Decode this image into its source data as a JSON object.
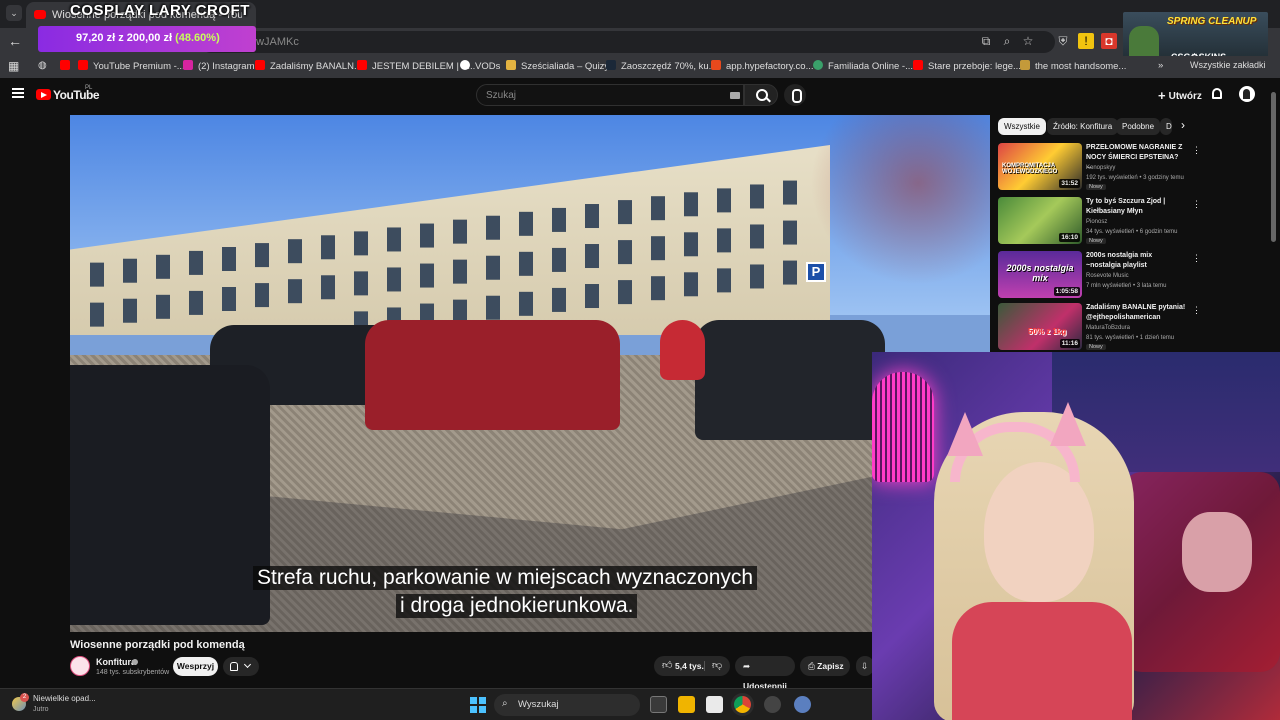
{
  "browser": {
    "active_tab_title": "Wiosenne porządki pod komendą - YouTube",
    "url_visible": "...DobFwJAMKc",
    "bookmarks": [
      {
        "label": "YouTube Premium -..."
      },
      {
        "label": "(2) Instagram"
      },
      {
        "label": "Zadaliśmy BANALN..."
      },
      {
        "label": "JESTEM DEBILEM | Z..."
      },
      {
        "label": "VODs"
      },
      {
        "label": "Sześcialiada – Quizy..."
      },
      {
        "label": "Zaoszczędź 70%, ku..."
      },
      {
        "label": "app.hypefactory.co..."
      },
      {
        "label": "Familiada Online -..."
      },
      {
        "label": "Stare przeboje: lege..."
      },
      {
        "label": "the most handsome..."
      }
    ],
    "all_bookmarks_label": "Wszystkie zakładki"
  },
  "stream_overlay": {
    "title": "COSPLAY LARY CROFT",
    "donation_amount": "97,20 zł",
    "donation_sep": "z",
    "donation_goal": "200,00 zł",
    "donation_pct": "(48.60%)",
    "promo_line1": "SPRING CLEANUP",
    "promo_line2": "CSG⚙SKINS"
  },
  "youtube": {
    "logo_text": "YouTube",
    "logo_region": "PL",
    "search_placeholder": "Szukaj",
    "create_label": "Utwórz",
    "video": {
      "subtitle_line1": "Strefa ruchu, parkowanie w miejscach wyznaczonych",
      "subtitle_line2": "i droga jednokierunkowa.",
      "title": "Wiosenne porządki pod komendą",
      "channel": "Konfitura",
      "subscribers": "148 tys. subskrybentów",
      "support_label": "Wesprzyj",
      "likes": "5,4 tys.",
      "share_label": "Udostępnij",
      "save_label": "Zapisz"
    },
    "chips": [
      "Wszystkie",
      "Źródło: Konfitura",
      "Podobne",
      "Dla"
    ],
    "recommendations": [
      {
        "title": "PRZEŁOMOWE NAGRANIE Z NOCY ŚMIERCI EPSTEINA? ...",
        "channel": "Konopskyy",
        "meta": "192 tys. wyświetleń • 3 godziny temu",
        "badge": "Nowy",
        "duration": "31:52",
        "thumb_label": "KOMPROMITACJA WOJEWÓDZKIEGO"
      },
      {
        "title": "Ty to byś Szczura Zjod | Kiełbasiany Młyn",
        "channel": "Pionosz",
        "meta": "34 tys. wyświetleń • 6 godzin temu",
        "badge": "Nowy",
        "duration": "16:10",
        "thumb_label": ""
      },
      {
        "title": "2000s nostalgia mix ~nostalgia playlist",
        "channel": "Rosevote Music",
        "meta": "7 mln wyświetleń • 3 lata temu",
        "badge": "",
        "duration": "1:05:58",
        "thumb_label": "2000s nostalgia mix"
      },
      {
        "title": "Zadaliśmy BANALNE pytania! @ejthepolishamerican",
        "channel": "MaturaToBzdura",
        "meta": "81 tys. wyświetleń • 1 dzień temu",
        "badge": "Nowy",
        "duration": "11:16",
        "thumb_label": "50% z 1kg"
      }
    ]
  },
  "taskbar": {
    "weather_text": "Niewielkie opad...",
    "weather_sub": "Jutro",
    "weather_badge": "2",
    "search_label": "Wyszukaj"
  }
}
